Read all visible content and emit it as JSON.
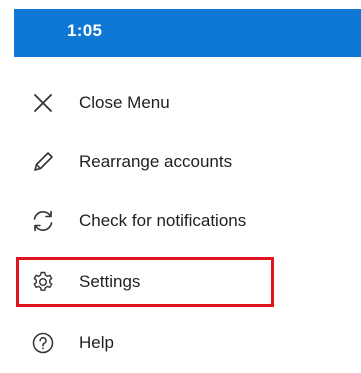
{
  "status_bar": {
    "time": "1:05",
    "background": "#0f78d4"
  },
  "menu": {
    "items": [
      {
        "label": "Close Menu",
        "icon": "close-icon"
      },
      {
        "label": "Rearrange accounts",
        "icon": "pencil-icon"
      },
      {
        "label": "Check for notifications",
        "icon": "refresh-icon"
      },
      {
        "label": "Settings",
        "icon": "gear-icon"
      },
      {
        "label": "Help",
        "icon": "help-icon"
      }
    ]
  },
  "highlight": {
    "target": "Settings",
    "color": "#e0141e"
  }
}
